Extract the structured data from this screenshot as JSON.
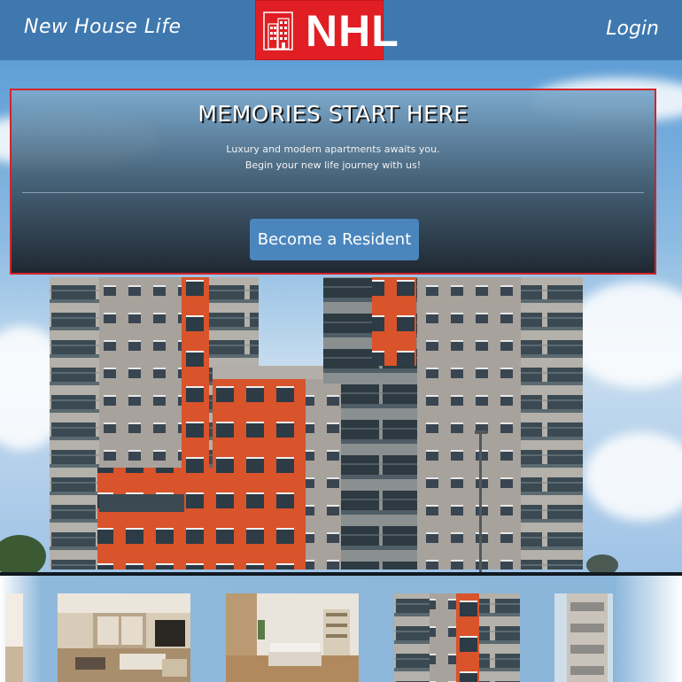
{
  "header": {
    "brand": "New House Life",
    "logo_text": "NHL",
    "login_label": "Login"
  },
  "hero": {
    "title": "MEMORIES START HERE",
    "subtitle_line1": "Luxury and modern apartments awaits you.",
    "subtitle_line2": "Begin your new life journey with us!",
    "cta_label": "Become a Resident"
  },
  "gallery": {
    "items": [
      "living-room-photo",
      "bedroom-photo",
      "apartment-building-photo",
      "balcony-building-photo"
    ]
  },
  "colors": {
    "header_bg": "#3f78ae",
    "logo_bg": "#e01e24",
    "panel_border": "#d4232b",
    "button_bg": "#4a86bd",
    "gallery_bg": "#8ab6da"
  },
  "icons": {
    "logo": "building-icon"
  }
}
